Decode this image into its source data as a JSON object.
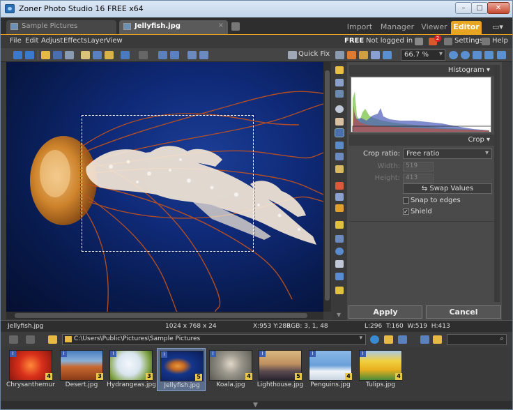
{
  "window": {
    "title": "Zoner Photo Studio 16 FREE x64",
    "controls": {
      "minimize": "–",
      "maximize": "□",
      "close": "✕"
    }
  },
  "tabs": {
    "documents": [
      {
        "label": "Sample Pictures",
        "close": ""
      },
      {
        "label": "Jellyfish.jpg",
        "close": "×"
      }
    ],
    "modes": [
      "Import",
      "Manager",
      "Viewer",
      "Editor"
    ],
    "active_mode": "Editor"
  },
  "menu": {
    "items": [
      "File",
      "Edit",
      "Adjust",
      "Effects",
      "Layer",
      "View"
    ],
    "right": {
      "free": "FREE",
      "login": "Not logged in ▾",
      "cart_badge": "2",
      "settings": "Settings",
      "help": "Help"
    }
  },
  "toolbar": {
    "quick_fix": "Quick Fix",
    "zoom": "66.7 %",
    "zoom_arrow": "▾"
  },
  "panel": {
    "histogram_title": "Histogram ▾",
    "crop_title": "Crop ▾",
    "crop_ratio_label": "Crop ratio:",
    "crop_ratio_value": "Free ratio",
    "width_label": "Width:",
    "width_value": "519",
    "height_label": "Height:",
    "height_value": "413",
    "swap_label": "Swap Values",
    "snap_label": "Snap to edges",
    "snap_checked": false,
    "shield_label": "Shield",
    "shield_checked": true,
    "apply": "Apply",
    "cancel": "Cancel"
  },
  "status": {
    "filename": "Jellyfish.jpg",
    "dimensions": "1024 x 768 x 24",
    "cursor": "X:953 Y:288",
    "rgb": "RGB: 3, 1, 48",
    "crop_info": "L:296  T:160  W:519  H:413"
  },
  "navigator": {
    "path": "C:\\Users\\Public\\Pictures\\Sample Pictures"
  },
  "filmstrip": [
    {
      "name": "Chrysanthemum...",
      "rating": "4",
      "color": "#c4301a",
      "accent": "#ff7a2a"
    },
    {
      "name": "Desert.jpg",
      "rating": "3",
      "color": "#a8502a",
      "accent": "#4a7ec0"
    },
    {
      "name": "Hydrangeas.jpg",
      "rating": "3",
      "color": "#dfe8f0",
      "accent": "#7da040"
    },
    {
      "name": "Jellyfish.jpg",
      "rating": "5",
      "color": "#0d2a80",
      "accent": "#e49a40"
    },
    {
      "name": "Koala.jpg",
      "rating": "4",
      "color": "#8a8880",
      "accent": "#d8d0c0"
    },
    {
      "name": "Lighthouse.jpg",
      "rating": "5",
      "color": "#c0a070",
      "accent": "#3a3040"
    },
    {
      "name": "Penguins.jpg",
      "rating": "4",
      "color": "#6aa0d8",
      "accent": "#f4f4f4"
    },
    {
      "name": "Tulips.jpg",
      "rating": "4",
      "color": "#e8c020",
      "accent": "#4a8a3a"
    }
  ],
  "bottom": {
    "arrow": "▼"
  }
}
